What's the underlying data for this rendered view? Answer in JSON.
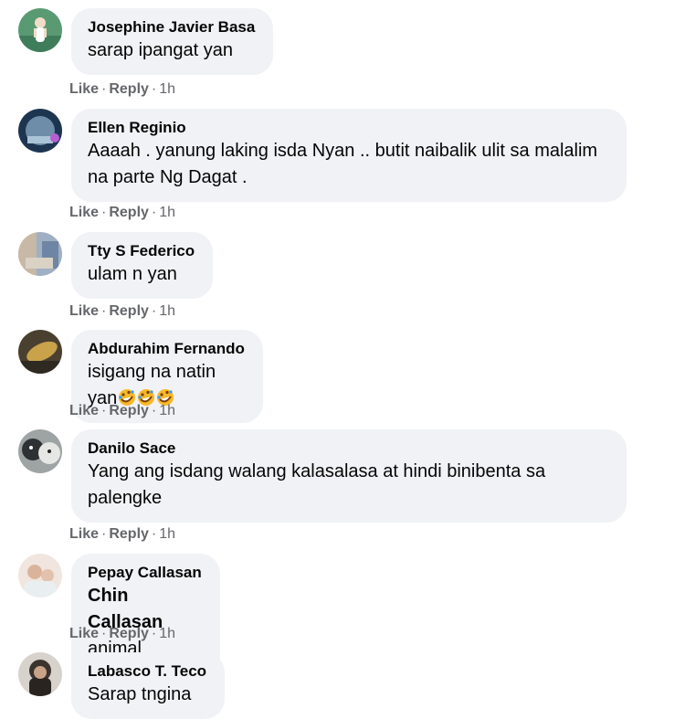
{
  "comments": [
    {
      "author": "Josephine Javier Basa",
      "text": "sarap ipangat yan",
      "like": "Like",
      "reply": "Reply",
      "time": "1h",
      "avatar_color": "#3f7d5a"
    },
    {
      "author": "Ellen Reginio",
      "text": "Aaaah . yanung laking isda Nyan .. butit naibalik ulit sa malalim na parte Ng Dagat .",
      "like": "Like",
      "reply": "Reply",
      "time": "1h",
      "avatar_color": "#2c4a66"
    },
    {
      "author": "Tty S Federico",
      "text": "ulam n yan",
      "like": "Like",
      "reply": "Reply",
      "time": "1h",
      "avatar_color": "#8a9ab0"
    },
    {
      "author": "Abdurahim Fernando",
      "text": "isigang na natin yan",
      "emoji": "rolling-on-floor-laughing",
      "emoji_count": 3,
      "like": "Like",
      "reply": "Reply",
      "time": "1h",
      "avatar_color": "#8b7a55"
    },
    {
      "author": "Danilo Sace",
      "text": "Yang ang isdang walang kalasalasa at hindi binibenta sa palengke",
      "like": "Like",
      "reply": "Reply",
      "time": "1h",
      "avatar_color": "#6f7475"
    },
    {
      "author": "Pepay Callasan",
      "mention": "Chin Callasan",
      "text": " animal crossing",
      "like": "Like",
      "reply": "Reply",
      "time": "1h",
      "avatar_color": "#c9a48f"
    },
    {
      "author": "Labasco T. Teco",
      "text": "Sarap tngina",
      "avatar_color": "#3b332d"
    }
  ],
  "colors": {
    "bubble": "#f0f2f5",
    "text": "#050505",
    "muted": "#65676b"
  }
}
